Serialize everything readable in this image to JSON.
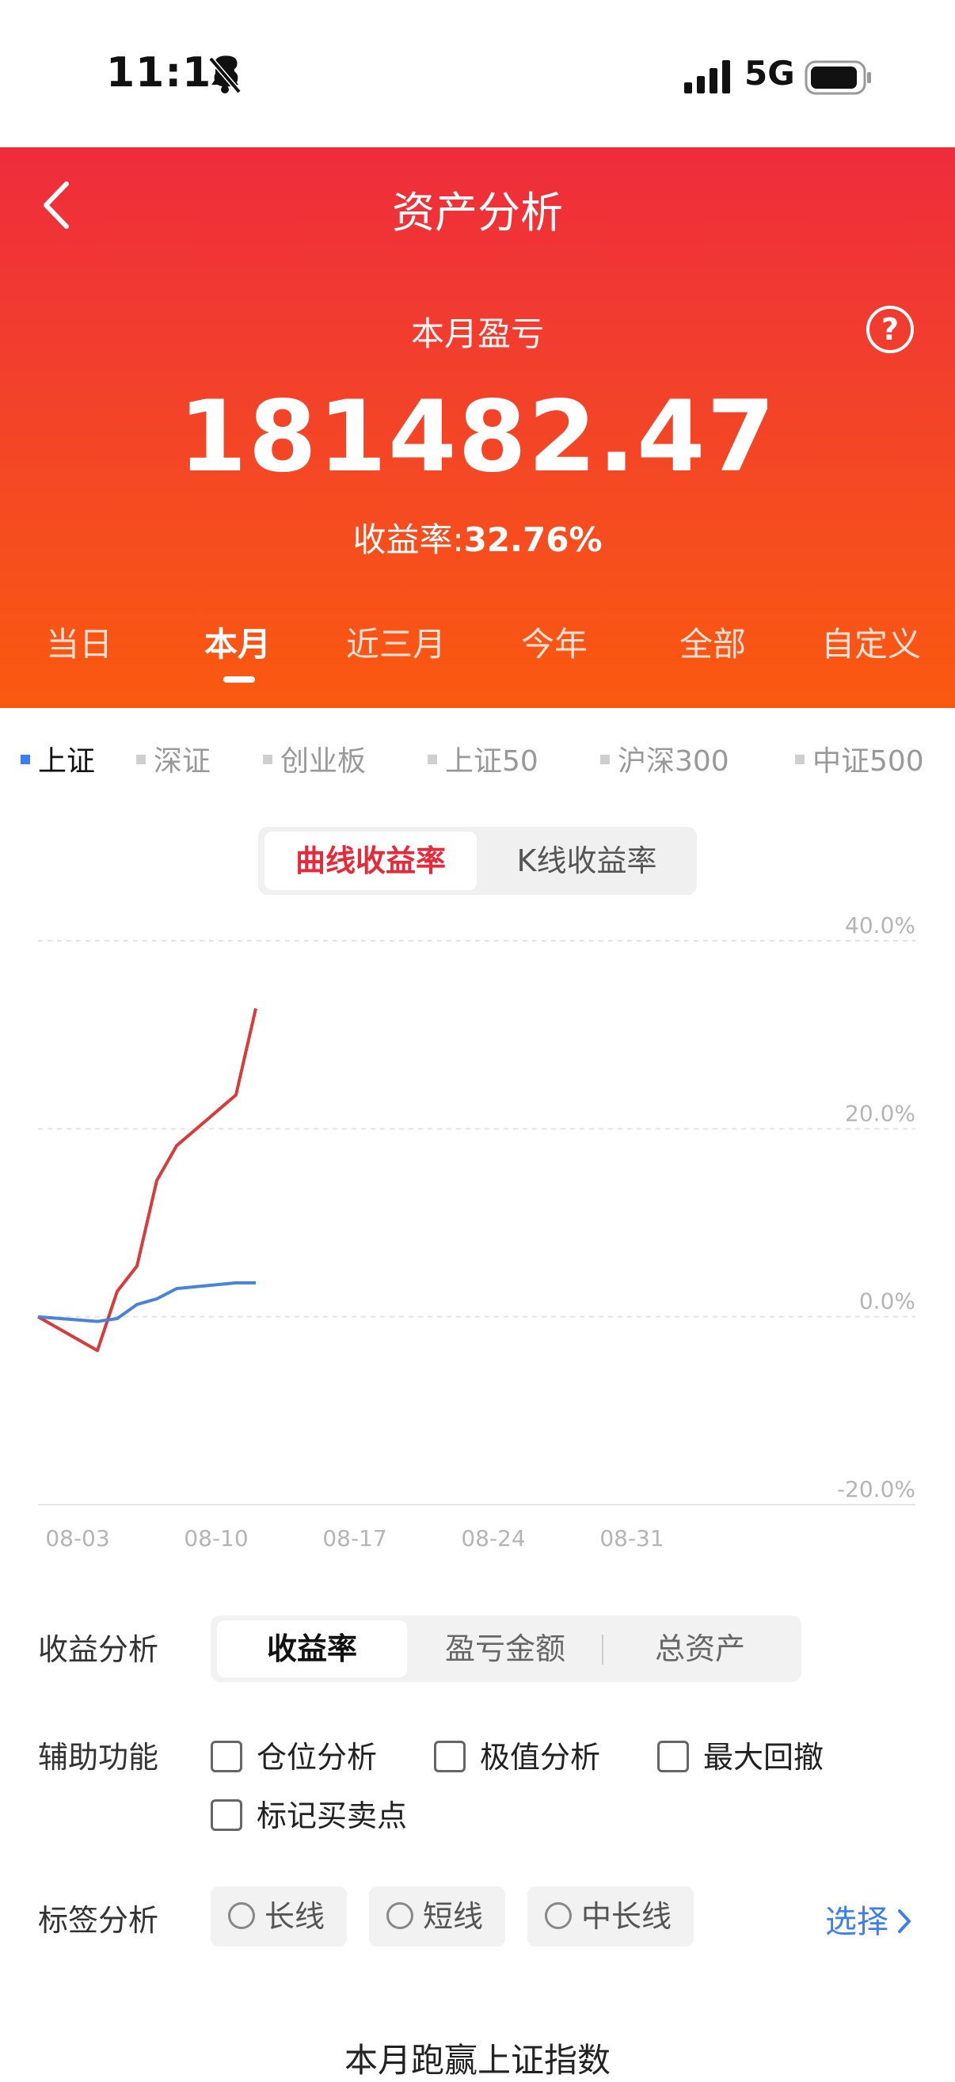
{
  "status_bar": {
    "time": "11:18",
    "network": "5G",
    "bell_icon": "bell-slash-icon",
    "signal_icon": "signal-bars-icon",
    "battery_icon": "battery-icon"
  },
  "header": {
    "title": "资产分析",
    "back_icon": "chevron-left-icon",
    "help_icon": "question-circle-icon",
    "subtitle": "本月盈亏",
    "amount": "181482.47",
    "rate_label": "收益率:",
    "rate_value": "32.76%",
    "colors": {
      "top": "#ee2c3c",
      "bottom": "#fa5a10"
    }
  },
  "period_tabs": [
    {
      "label": "当日",
      "active": false
    },
    {
      "label": "本月",
      "active": true
    },
    {
      "label": "近三月",
      "active": false
    },
    {
      "label": "今年",
      "active": false
    },
    {
      "label": "全部",
      "active": false
    },
    {
      "label": "自定义",
      "active": false
    }
  ],
  "index_tabs": [
    {
      "label": "上证",
      "active": true
    },
    {
      "label": "深证",
      "active": false
    },
    {
      "label": "创业板",
      "active": false
    },
    {
      "label": "上证50",
      "active": false
    },
    {
      "label": "沪深300",
      "active": false
    },
    {
      "label": "中证500",
      "active": false
    }
  ],
  "chart_toggle": {
    "active": "曲线收益率",
    "inactive": "K线收益率"
  },
  "chart_data": {
    "type": "line",
    "y_ticks": [
      "40.0%",
      "20.0%",
      "0.0%",
      "-20.0%"
    ],
    "x_ticks": [
      "08-03",
      "08-10",
      "08-17",
      "08-24",
      "08-31"
    ],
    "ylim": [
      -20,
      40
    ],
    "xlim": [
      0,
      31
    ],
    "grid": true,
    "series": [
      {
        "color": "#d93a3a",
        "x": [
          0,
          3,
          4,
          5,
          6,
          7,
          10,
          11
        ],
        "y": [
          0.0,
          -3.6,
          2.7,
          5.4,
          14.5,
          18.2,
          23.6,
          32.8
        ]
      },
      {
        "color": "#4a82d8",
        "x": [
          0,
          3,
          4,
          5,
          6,
          7,
          10,
          11
        ],
        "y": [
          0.0,
          -0.5,
          -0.2,
          1.3,
          1.9,
          3.0,
          3.6,
          3.6
        ]
      }
    ]
  },
  "analysis": {
    "income_label": "收益分析",
    "income_tabs": [
      "收益率",
      "盈亏金额",
      "总资产"
    ],
    "aux_label": "辅助功能",
    "aux_options": [
      "仓位分析",
      "极值分析",
      "最大回撤",
      "标记买卖点"
    ],
    "tag_label": "标签分析",
    "tag_options": [
      "长线",
      "短线",
      "中长线"
    ],
    "select_label": "选择",
    "select_icon": "chevron-right-icon"
  },
  "bottom_title": "本月跑赢上证指数"
}
